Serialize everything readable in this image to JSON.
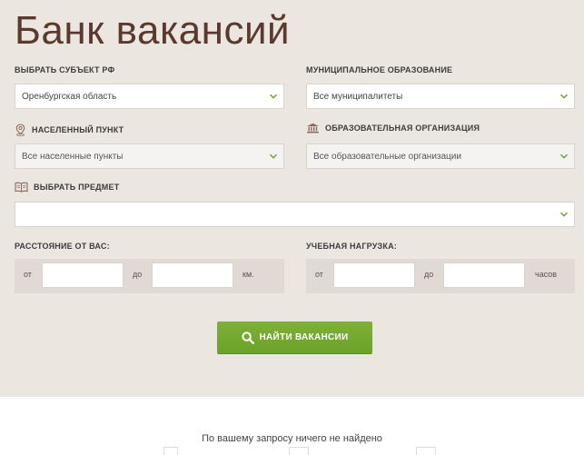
{
  "page": {
    "title": "Банк вакансий",
    "empty_message": "По вашему запросу ничего не найдено"
  },
  "filters": {
    "region": {
      "label": "Выбрать субъект РФ",
      "value": "Оренбургская область"
    },
    "municipality": {
      "label": "Муниципальное образование",
      "value": "Все муниципалитеты"
    },
    "settlement": {
      "label": "Населенный пункт",
      "value": "Все населенные пункты",
      "icon": "location-pin-icon"
    },
    "organization": {
      "label": "Образовательная организация",
      "value": "Все образовательные организации",
      "icon": "institution-icon"
    },
    "subject": {
      "label": "Выбрать предмет",
      "value": "",
      "icon": "book-icon"
    },
    "distance": {
      "label": "Расстояние от вас:",
      "from": "от",
      "to": "до",
      "unit": "км."
    },
    "workload": {
      "label": "Учебная нагрузка:",
      "from": "от",
      "to": "до",
      "unit": "часов"
    }
  },
  "search_button": {
    "label": "Найти вакансии",
    "icon": "search-icon"
  },
  "colors": {
    "panel_bg": "#ece6e1",
    "title": "#5a3a2c",
    "accent_green": "#76aa2f"
  }
}
